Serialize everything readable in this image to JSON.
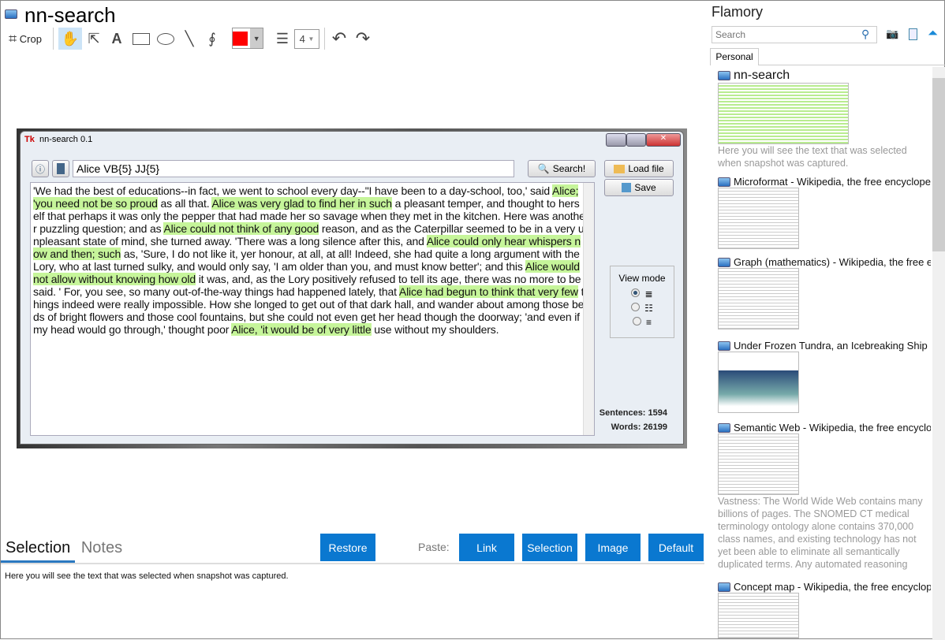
{
  "app": {
    "title": "nn-search"
  },
  "toolbar": {
    "crop": "Crop",
    "line_width": "4",
    "color": "#ff0000"
  },
  "window": {
    "title": "nn-search 0.1",
    "query": "Alice VB{5} JJ{5}",
    "search": "Search!",
    "load": "Load file",
    "save": "Save",
    "view_mode": "View mode",
    "sentences": "Sentences: 1594",
    "words": "Words: 26199",
    "lines": [
      [
        {
          "t": "'We had the best of educations--in fact, we went to school every day--\"I have been to a day-school, too,' said "
        },
        {
          "t": "Alice;",
          "h": 1
        }
      ],
      [
        {
          "t": "'you need not be so proud",
          "h": 1
        },
        {
          "t": " as all that. "
        },
        {
          "t": "Alice was very glad to find her in such",
          "h": 1
        },
        {
          "t": " a pleasant temper, and thought to hers"
        }
      ],
      [
        {
          "t": "elf that perhaps it was only the pepper that had made her so savage when they met in the kitchen. Here was anothe"
        }
      ],
      [
        {
          "t": "r puzzling question; and as "
        },
        {
          "t": "Alice could not think of any good",
          "h": 1
        },
        {
          "t": " reason, and as the Caterpillar seemed to be in a very u"
        }
      ],
      [
        {
          "t": "npleasant state of mind, she turned away. 'There was a long silence after this, and "
        },
        {
          "t": "Alice could only hear whispers n",
          "h": 1
        }
      ],
      [
        {
          "t": "ow and then; such",
          "h": 1
        },
        {
          "t": " as, 'Sure, I do not like it, yer honour, at all, at all! Indeed, she had quite a long argument with the"
        }
      ],
      [
        {
          "t": "Lory, who at last turned sulky, and would only say, 'I am older than you, and must know better'; and this "
        },
        {
          "t": "Alice would",
          "h": 1
        }
      ],
      [
        {
          "t": "not allow without knowing how old",
          "h": 1
        },
        {
          "t": " it was, and, as the Lory positively refused to tell its age, there was no more to be"
        }
      ],
      [
        {
          "t": "said. ' For, you see, so many out-of-the-way things had happened lately, that "
        },
        {
          "t": "Alice had begun to think that very few",
          "h": 1
        },
        {
          "t": " t"
        }
      ],
      [
        {
          "t": "hings indeed were really impossible. How she longed to get out of that dark hall, and wander about among those be"
        }
      ],
      [
        {
          "t": "ds of bright flowers and those cool fountains, but she could not even get her head though the doorway; 'and even if"
        }
      ],
      [
        {
          "t": "my head would go through,' thought poor "
        },
        {
          "t": "Alice, 'it would be of very little",
          "h": 1
        },
        {
          "t": " use without my shoulders."
        }
      ]
    ]
  },
  "bottom": {
    "tabs": [
      "Selection",
      "Notes"
    ],
    "restore": "Restore",
    "paste": "Paste:",
    "link": "Link",
    "selection": "Selection",
    "image": "Image",
    "default": "Default",
    "text": "Here you will see the text that was selected when snapshot was captured."
  },
  "side": {
    "title": "Flamory",
    "search_placeholder": "Search",
    "tab": "Personal",
    "items": [
      {
        "title": "nn-search",
        "desc": "Here you will see the text that was selected when snapshot was captured."
      },
      {
        "title": "Microformat - Wikipedia, the free encyclopedia",
        "desc": ""
      },
      {
        "title": "Graph (mathematics) - Wikipedia, the free encyclopedia",
        "desc": ""
      },
      {
        "title": "Under Frozen Tundra, an Icebreaking Ship Uncovers",
        "desc": ""
      },
      {
        "title": "Semantic Web - Wikipedia, the free encyclopedia",
        "desc": "Vastness: The World Wide Web contains many billions of pages. The SNOMED CT medical terminology ontology alone contains 370,000 class names, and existing technology has not yet been able to eliminate all semantically duplicated terms. Any automated reasoning system will have to deal with truly huge inputs."
      },
      {
        "title": "Concept map - Wikipedia, the free encyclopedia",
        "desc": ""
      }
    ]
  }
}
